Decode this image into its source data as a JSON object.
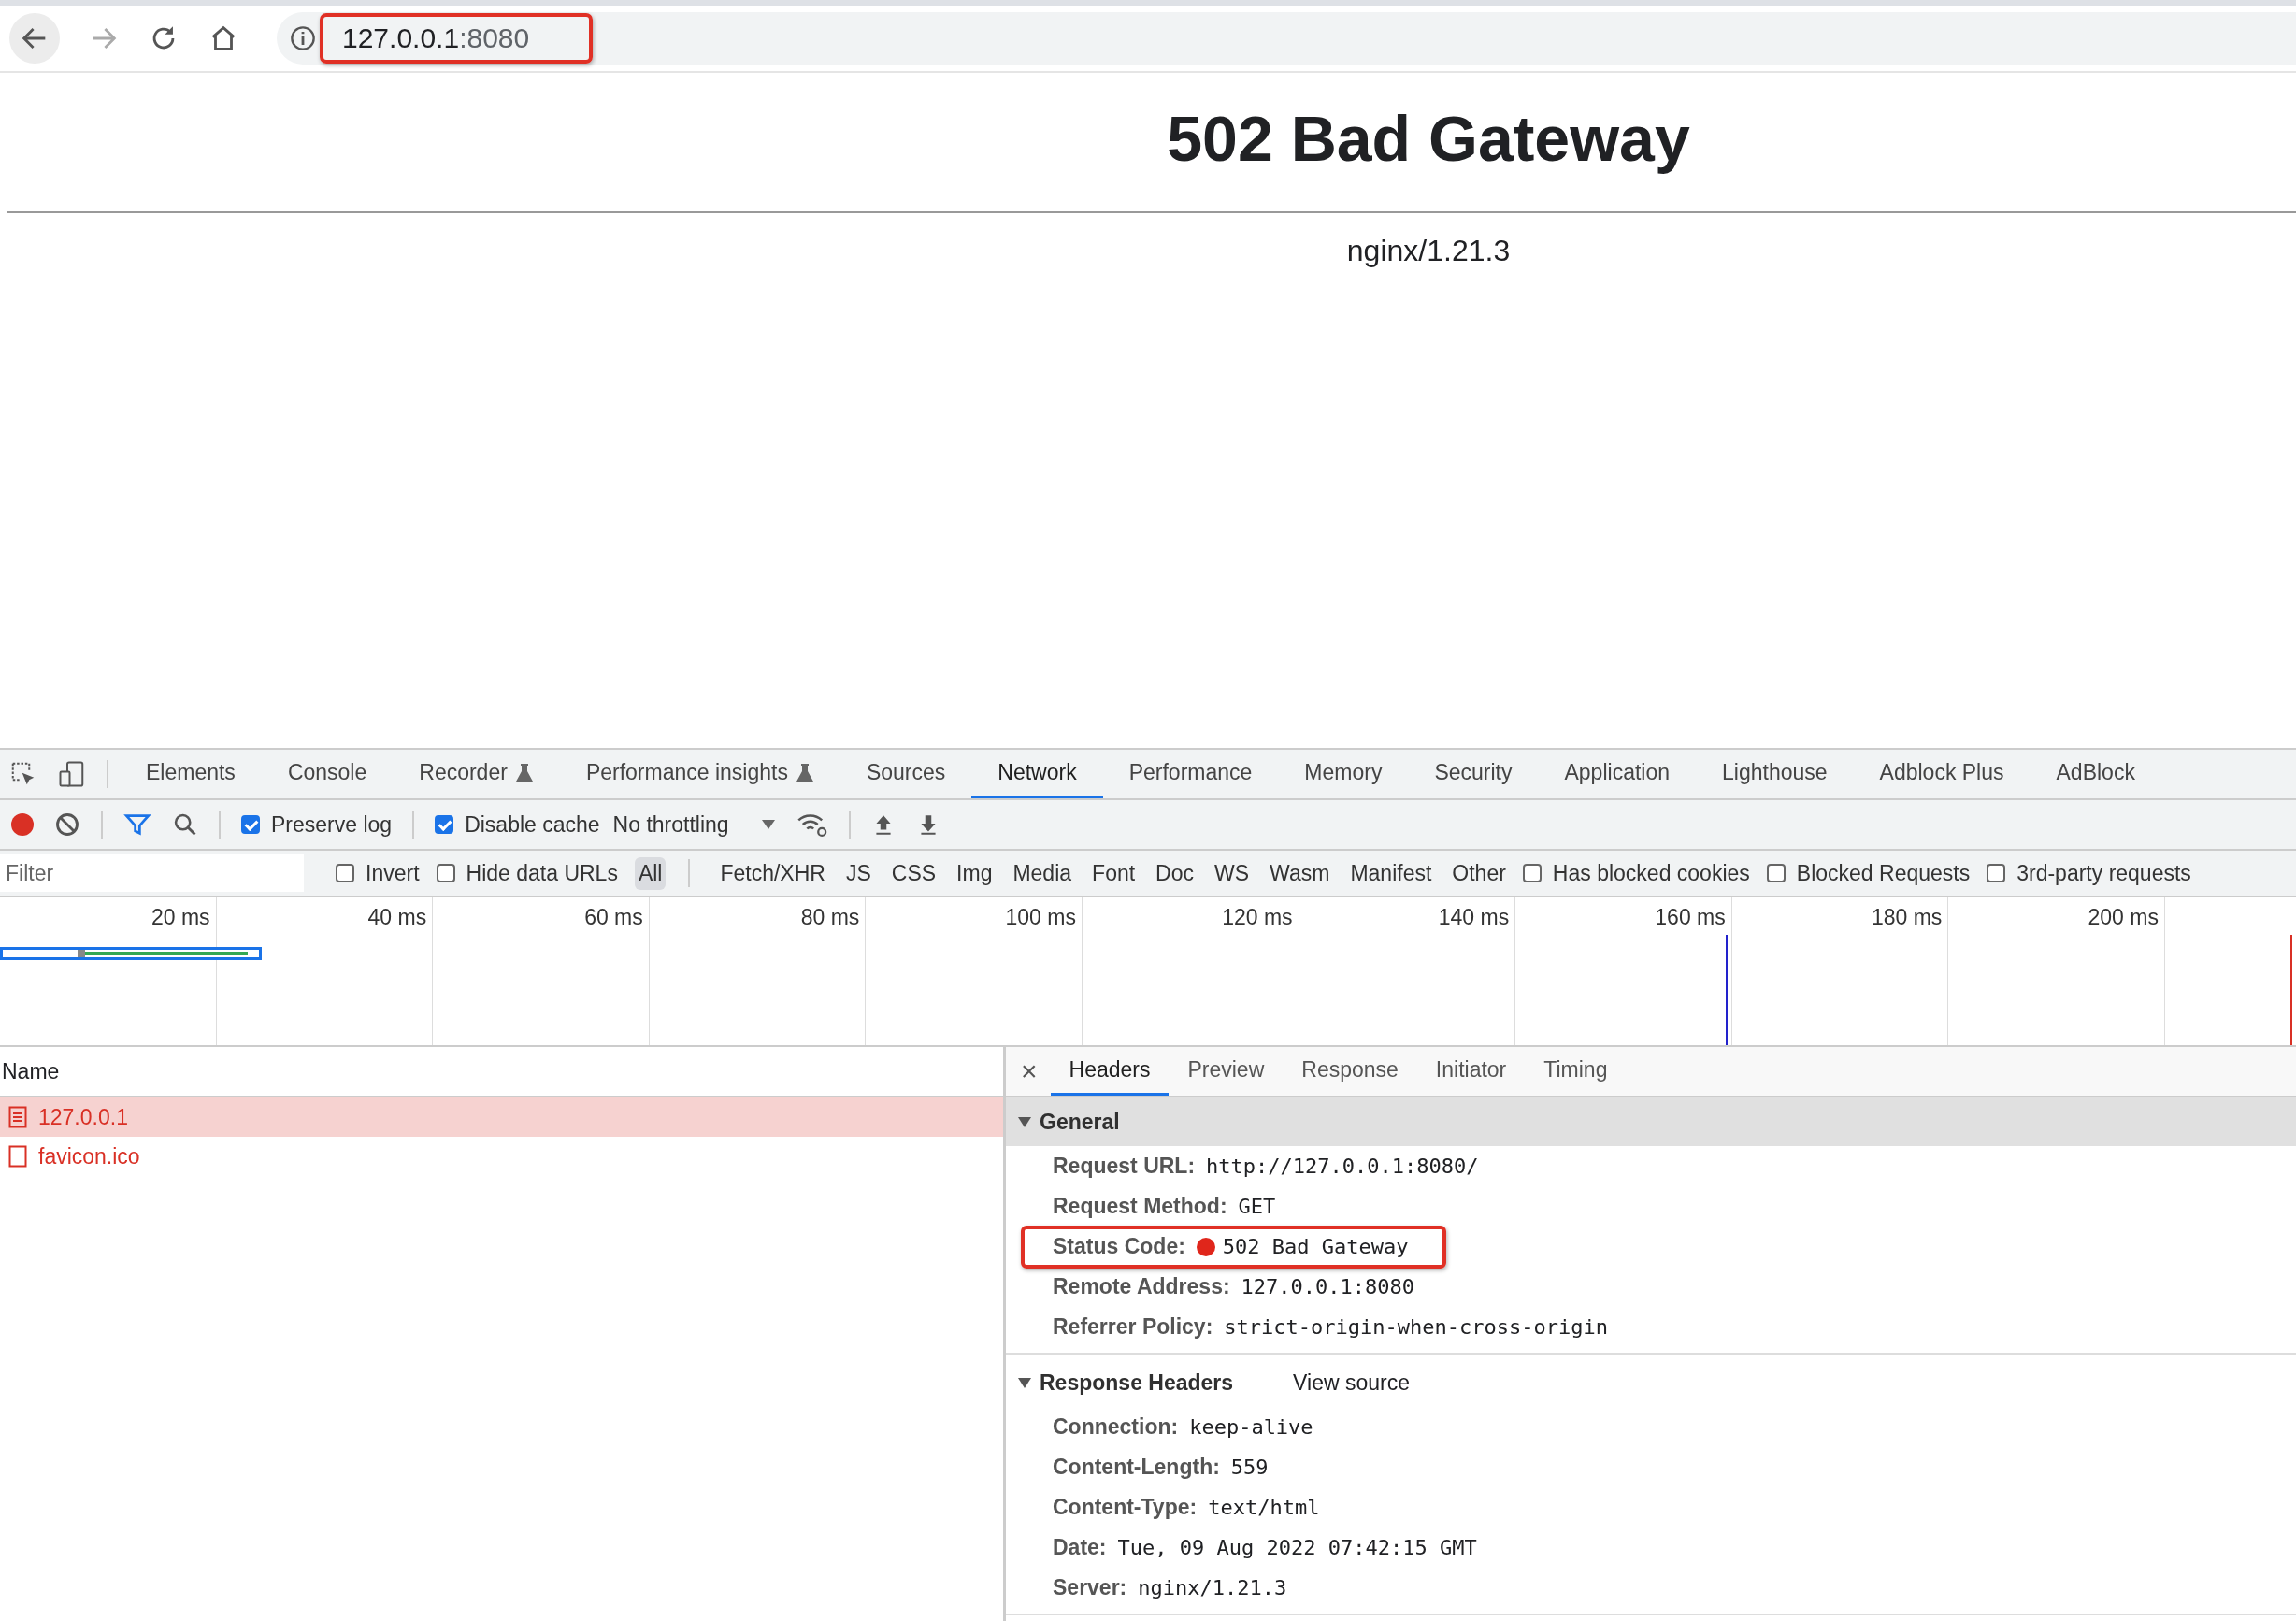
{
  "browser": {
    "url_host": "127.0.0.1",
    "url_port": ":8080",
    "highlighted": true
  },
  "page": {
    "heading": "502 Bad Gateway",
    "footer": "nginx/1.21.3"
  },
  "devtools": {
    "tabs": [
      {
        "label": "Elements",
        "selected": false,
        "experimental": false
      },
      {
        "label": "Console",
        "selected": false,
        "experimental": false
      },
      {
        "label": "Recorder",
        "selected": false,
        "experimental": true
      },
      {
        "label": "Performance insights",
        "selected": false,
        "experimental": true
      },
      {
        "label": "Sources",
        "selected": false,
        "experimental": false
      },
      {
        "label": "Network",
        "selected": true,
        "experimental": false
      },
      {
        "label": "Performance",
        "selected": false,
        "experimental": false
      },
      {
        "label": "Memory",
        "selected": false,
        "experimental": false
      },
      {
        "label": "Security",
        "selected": false,
        "experimental": false
      },
      {
        "label": "Application",
        "selected": false,
        "experimental": false
      },
      {
        "label": "Lighthouse",
        "selected": false,
        "experimental": false
      },
      {
        "label": "Adblock Plus",
        "selected": false,
        "experimental": false
      },
      {
        "label": "AdBlock",
        "selected": false,
        "experimental": false
      }
    ],
    "toolbar": {
      "recording": true,
      "preserve_log": {
        "label": "Preserve log",
        "checked": true
      },
      "disable_cache": {
        "label": "Disable cache",
        "checked": true
      },
      "throttling": "No throttling"
    },
    "filter": {
      "placeholder": "Filter",
      "options_left": [
        {
          "label": "Invert",
          "checked": false
        },
        {
          "label": "Hide data URLs",
          "checked": false
        }
      ],
      "types": [
        {
          "label": "All",
          "selected": true
        },
        {
          "label": "Fetch/XHR",
          "selected": false
        },
        {
          "label": "JS",
          "selected": false
        },
        {
          "label": "CSS",
          "selected": false
        },
        {
          "label": "Img",
          "selected": false
        },
        {
          "label": "Media",
          "selected": false
        },
        {
          "label": "Font",
          "selected": false
        },
        {
          "label": "Doc",
          "selected": false
        },
        {
          "label": "WS",
          "selected": false
        },
        {
          "label": "Wasm",
          "selected": false
        },
        {
          "label": "Manifest",
          "selected": false
        },
        {
          "label": "Other",
          "selected": false
        }
      ],
      "options_right": [
        {
          "label": "Has blocked cookies",
          "checked": false
        },
        {
          "label": "Blocked Requests",
          "checked": false
        },
        {
          "label": "3rd-party requests",
          "checked": false
        }
      ]
    },
    "timeline": {
      "ticks": [
        "20 ms",
        "40 ms",
        "60 ms",
        "80 ms",
        "100 ms",
        "120 ms",
        "140 ms",
        "160 ms",
        "180 ms",
        "200 ms"
      ]
    },
    "requests": {
      "column": "Name",
      "rows": [
        {
          "name": "127.0.0.1",
          "kind": "document",
          "selected": true,
          "failed": true
        },
        {
          "name": "favicon.ico",
          "kind": "other",
          "selected": false,
          "failed": true
        }
      ]
    },
    "details": {
      "close": "×",
      "tabs": [
        {
          "label": "Headers",
          "selected": true
        },
        {
          "label": "Preview",
          "selected": false
        },
        {
          "label": "Response",
          "selected": false
        },
        {
          "label": "Initiator",
          "selected": false
        },
        {
          "label": "Timing",
          "selected": false
        }
      ],
      "sections": [
        {
          "title": "General",
          "expanded": true,
          "shaded": true,
          "headers": [
            {
              "name": "Request URL:",
              "value": "http://127.0.0.1:8080/",
              "kind": "plain",
              "highlighted": false
            },
            {
              "name": "Request Method:",
              "value": "GET",
              "kind": "plain",
              "highlighted": false
            },
            {
              "name": "Status Code:",
              "value": "502 Bad Gateway",
              "kind": "status",
              "color": "#e0261b",
              "highlighted": true
            },
            {
              "name": "Remote Address:",
              "value": "127.0.0.1:8080",
              "kind": "plain",
              "highlighted": false
            },
            {
              "name": "Referrer Policy:",
              "value": "strict-origin-when-cross-origin",
              "kind": "plain",
              "highlighted": false
            }
          ]
        },
        {
          "title": "Response Headers",
          "expanded": true,
          "shaded": false,
          "link": "View source",
          "headers": [
            {
              "name": "Connection:",
              "value": "keep-alive",
              "kind": "plain",
              "highlighted": false
            },
            {
              "name": "Content-Length:",
              "value": "559",
              "kind": "plain",
              "highlighted": false
            },
            {
              "name": "Content-Type:",
              "value": "text/html",
              "kind": "plain",
              "highlighted": false
            },
            {
              "name": "Date:",
              "value": "Tue, 09 Aug 2022 07:42:15 GMT",
              "kind": "plain",
              "highlighted": false
            },
            {
              "name": "Server:",
              "value": "nginx/1.21.3",
              "kind": "plain",
              "highlighted": false
            }
          ]
        }
      ]
    }
  }
}
